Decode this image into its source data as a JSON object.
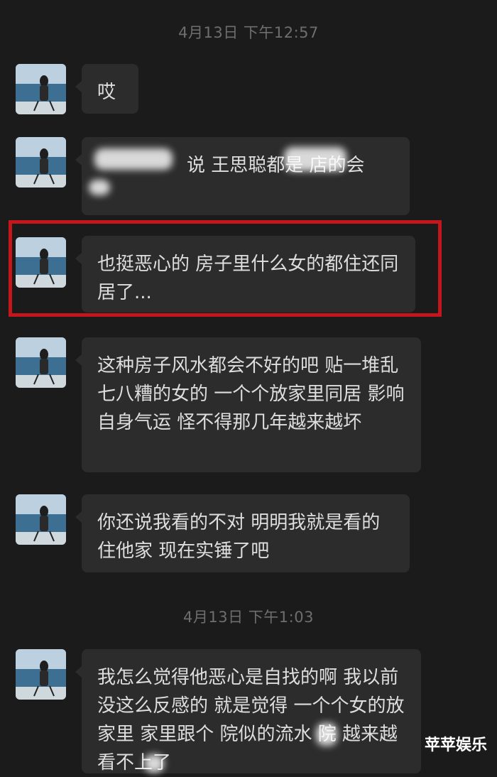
{
  "timestamps": [
    "4月13日 下午12:57",
    "4月13日 下午1:03"
  ],
  "messages": [
    {
      "text": "哎"
    },
    {
      "text": "说 王思聪都是 店的会"
    },
    {
      "text": "也挺恶心的 房子里什么女的都住还同居了..."
    },
    {
      "text": "这种房子风水都会不好的吧 贴一堆乱七八糟的女的 一个个放家里同居 影响自身气运 怪不得那几年越来越坏"
    },
    {
      "text": "你还说我看的不对 明明我就是看的住他家 现在实锤了吧"
    },
    {
      "text": "我怎么觉得他恶心是自找的啊 我以前没这么反感的 就是觉得 一个个女的放家里 家里跟个 院似的流水 院 越来越看不上了"
    }
  ],
  "watermark": "苹苹娱乐",
  "colors": {
    "background": "#1b1b1b",
    "bubble": "#2c2c2c",
    "highlight": "#c4171b",
    "timestamp": "#6e6e6e"
  },
  "icons": {
    "avatar": "avatar-seaside-chair-icon"
  }
}
